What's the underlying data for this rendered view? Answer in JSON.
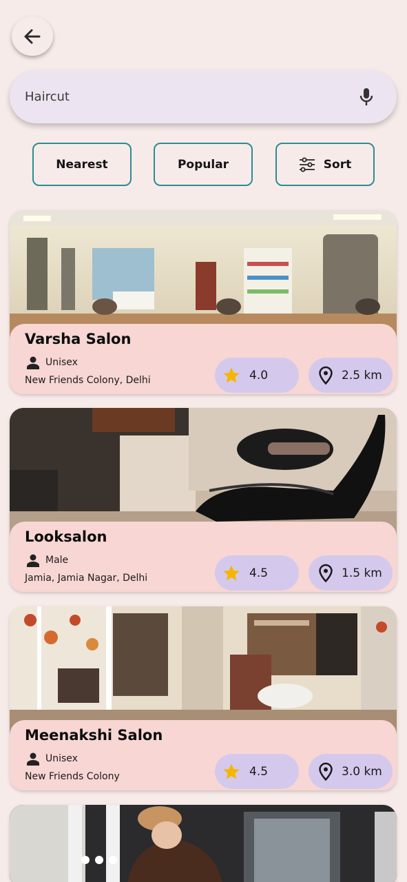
{
  "search": {
    "value": "Haircut",
    "icon": "mic-icon"
  },
  "filters": [
    {
      "label": "Nearest"
    },
    {
      "label": "Popular"
    },
    {
      "label": "Sort",
      "icon": "sliders-icon"
    }
  ],
  "colors": {
    "background": "#f7ebe9",
    "search_bg": "#ece4f0",
    "chip_border": "#2a8c94",
    "card_info_bg": "#f7d6d3",
    "pill_bg": "#d4c9ec",
    "star": "#f7b500"
  },
  "salons": [
    {
      "name": "Varsha Salon",
      "gender": "Unisex",
      "address": "New Friends Colony, Delhi",
      "rating": "4.0",
      "distance": "2.5 km"
    },
    {
      "name": "Looksalon",
      "gender": "Male",
      "address": "Jamia, Jamia Nagar, Delhi",
      "rating": "4.5",
      "distance": "1.5 km"
    },
    {
      "name": "Meenakshi Salon",
      "gender": "Unisex",
      "address": "New Friends Colony",
      "rating": "4.5",
      "distance": "3.0 km"
    }
  ]
}
